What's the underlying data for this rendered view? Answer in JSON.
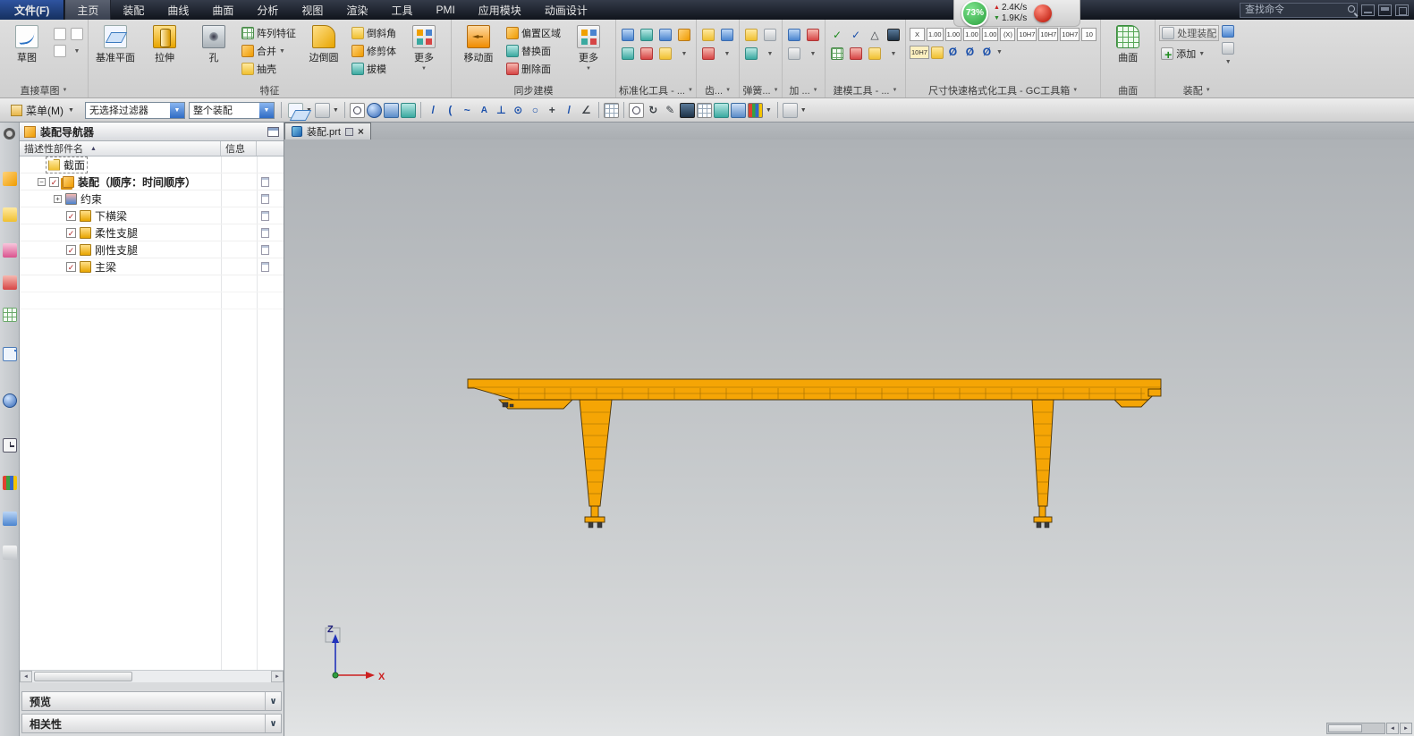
{
  "titlebar": {
    "search_placeholder": "查找命令",
    "perf_percent": "73%",
    "up_rate": "2.4K/s",
    "down_rate": "1.9K/s"
  },
  "tabs": {
    "file": "文件(F)",
    "items": [
      "主页",
      "装配",
      "曲线",
      "曲面",
      "分析",
      "视图",
      "渲染",
      "工具",
      "PMI",
      "应用模块",
      "动画设计"
    ]
  },
  "ribbon": {
    "sketch": {
      "label": "直接草图",
      "btn": "草图"
    },
    "feature": {
      "label": "特征",
      "datum": "基准平面",
      "extrude": "拉伸",
      "hole": "孔",
      "pattern": "阵列特征",
      "unite": "合并",
      "shell": "抽壳",
      "blend": "边倒圆",
      "chamfer": "倒斜角",
      "trim": "修剪体",
      "draft": "拔模",
      "more": "更多"
    },
    "sync": {
      "label": "同步建模",
      "move": "移动面",
      "offset": "偏置区域",
      "replace": "替换面",
      "delete": "删除面",
      "more": "更多"
    },
    "std": {
      "label": "标准化工具 - ..."
    },
    "gear": {
      "label": "齿..."
    },
    "spring": {
      "label": "弹簧..."
    },
    "prep": {
      "label": "加 ..."
    },
    "mtools": {
      "label": "建模工具 - ..."
    },
    "gc": {
      "label": "尺寸快速格式化工具 - GC工具箱",
      "badges1": [
        "X",
        "1.00",
        "1.00",
        "1.00",
        "1.00",
        "(X)",
        "10H7",
        "10H7",
        "10H7",
        "10"
      ],
      "badges2": [
        "10H7",
        "Ø",
        "Ø",
        "Ø"
      ]
    },
    "surface": {
      "label": "曲面",
      "btn": "曲面"
    },
    "assembly": {
      "label": "装配",
      "process": "处理装配",
      "add": "添加"
    }
  },
  "menubar": {
    "menu": "菜单(M)",
    "filter": "无选择过滤器",
    "scope": "整个装配"
  },
  "navigator": {
    "title": "装配导航器",
    "col_name": "描述性部件名",
    "col_info": "信息",
    "rows": [
      {
        "label": "截面"
      },
      {
        "label": "装配（顺序：时间顺序）"
      },
      {
        "label": "约束"
      },
      {
        "label": "下横梁"
      },
      {
        "label": "柔性支腿"
      },
      {
        "label": "刚性支腿"
      },
      {
        "label": "主梁"
      }
    ],
    "preview": "预览",
    "deps": "相关性"
  },
  "viewport": {
    "tab": "装配.prt",
    "triad_x": "X",
    "triad_z": "Z"
  },
  "icons": {
    "caret": "▼",
    "sort": "▲",
    "check": "✓",
    "plus": "+",
    "minus": "−",
    "close": "×",
    "chevron": "∨",
    "left": "◄",
    "right": "►",
    "up": "▲",
    "down": "▼",
    "slash": "/",
    "arc": "(",
    "tilde": "~",
    "letterA": "A",
    "perp": "⊥",
    "cdot": "⊙",
    "circle": "○",
    "cross": "+",
    "angle": "∠",
    "rotate": "↻",
    "pencil": "✎",
    "tri": "△"
  },
  "colors": {
    "crane": "#F5A505",
    "crane_outline": "#4a3205",
    "perf_green": "#2aa03c"
  }
}
